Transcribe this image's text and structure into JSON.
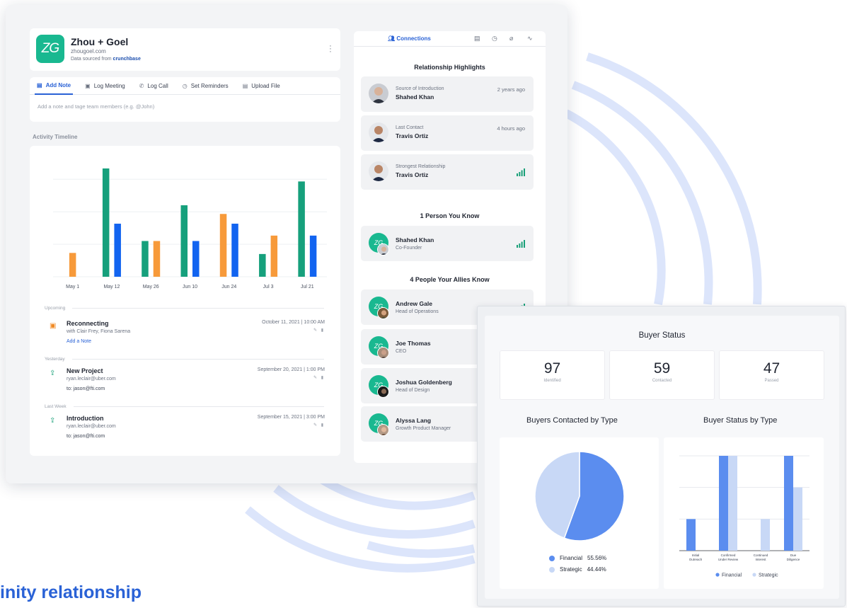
{
  "colors": {
    "accent": "#2a62d6",
    "brand_green": "#19b890",
    "teal_bar": "#16a07c",
    "orange_bar": "#f79a3a",
    "blue_bar": "#1264f0",
    "financial": "#5b8def",
    "strategic": "#c8d8f6"
  },
  "company": {
    "logo_text": "ZG",
    "name": "Zhou + Goel",
    "domain": "zhougoel.com",
    "source_prefix": "Data sourced from",
    "source_name": "crunchbase"
  },
  "note_tabs": [
    {
      "label": "Add Note",
      "icon": "note-icon"
    },
    {
      "label": "Log Meeting",
      "icon": "calendar-icon"
    },
    {
      "label": "Log Call",
      "icon": "phone-icon"
    },
    {
      "label": "Set Reminders",
      "icon": "alarm-icon"
    },
    {
      "label": "Upload File",
      "icon": "file-icon"
    }
  ],
  "note_placeholder": "Add a note and tage team members (e.g. @John)",
  "timeline_label": "Activity Timeline",
  "chart_data": {
    "type": "bar",
    "categories": [
      "May 1",
      "May 12",
      "May 26",
      "Jun 10",
      "Jun 24",
      "Jul 3",
      "Jul 21"
    ],
    "series": [
      {
        "values": [
          0,
          10,
          3.3,
          6.6,
          0,
          2.1,
          8.8
        ],
        "color": "#16a07c"
      },
      {
        "values": [
          2.2,
          0,
          3.3,
          0,
          5.8,
          3.8,
          0
        ],
        "color": "#f79a3a"
      },
      {
        "values": [
          0,
          4.9,
          0,
          3.3,
          4.9,
          0,
          3.8
        ],
        "color": "#1264f0"
      }
    ],
    "ylim": [
      0,
      10
    ],
    "grid": true
  },
  "timeline": {
    "sections": [
      {
        "label": "Upcoming",
        "event": {
          "icon": "calendar-icon",
          "title": "Reconnecting",
          "sub": "with Clair Frey, Fiona Sarena",
          "sub2": "Add a Note",
          "date": "October 11, 2021 | 10:00 AM"
        }
      },
      {
        "label": "Yesterday",
        "event": {
          "icon": "send-icon",
          "title": "New Project",
          "sub": "ryan.leclair@uber.com",
          "sub2": "to: jason@fti.com",
          "date": "September 20, 2021 | 1:00 PM"
        }
      },
      {
        "label": "Last Week",
        "event": {
          "icon": "send-icon",
          "title": "Introduction",
          "sub": "ryan.leclair@uber.com",
          "sub2": "to: jason@fti.com",
          "date": "September 15, 2021 | 3:00 PM"
        }
      }
    ]
  },
  "right_panel": {
    "tab_label": "Connections",
    "highlights_title": "Relationship Highlights",
    "highlights": [
      {
        "label": "Source of Introduction",
        "name": "Shahed Khan",
        "right": "2 years ago"
      },
      {
        "label": "Last Contact",
        "name": "Travis Ortiz",
        "right": "4 hours ago"
      },
      {
        "label": "Strongest Relationship",
        "name": "Travis Ortiz",
        "right": ""
      }
    ],
    "know_title": "1 Person You Know",
    "know": [
      {
        "name": "Shahed Khan",
        "role": "Co-Founder"
      }
    ],
    "allies_title": "4 People Your Allies Know",
    "allies": [
      {
        "name": "Andrew Gale",
        "role": "Head of Operations"
      },
      {
        "name": "Joe Thomas",
        "role": "CEO"
      },
      {
        "name": "Joshua Goldenberg",
        "role": "Head of Design"
      },
      {
        "name": "Alyssa Lang",
        "role": "Growth Product Manager"
      }
    ]
  },
  "buyer": {
    "title": "Buyer Status",
    "stats": [
      {
        "value": "97",
        "label": "Identified"
      },
      {
        "value": "59",
        "label": "Contacted"
      },
      {
        "value": "47",
        "label": "Passed"
      }
    ],
    "pie_title": "Buyers Contacted by Type",
    "bar_title": "Buyer Status by Type",
    "pie_legend": [
      {
        "label": "Financial",
        "value": "55.56%"
      },
      {
        "label": "Strategic",
        "value": "44.44%"
      }
    ],
    "bar_legend": [
      "Financial",
      "Strategic"
    ],
    "bar_categories": [
      [
        "Initial",
        "Outreach"
      ],
      [
        "Confirmed",
        "Under Review"
      ],
      [
        "Continued",
        "Interest"
      ],
      [
        "Due",
        "Diligence"
      ]
    ]
  },
  "buyer_pie_data": {
    "type": "pie",
    "slices": [
      {
        "name": "Financial",
        "value": 55.56
      },
      {
        "name": "Strategic",
        "value": 44.44
      }
    ]
  },
  "buyer_bar_data": {
    "type": "bar",
    "categories": [
      "Initial Outreach",
      "Confirmed Under Review",
      "Continued Interest",
      "Due Diligence"
    ],
    "series": [
      {
        "name": "Financial",
        "values": [
          1,
          3,
          0,
          3
        ]
      },
      {
        "name": "Strategic",
        "values": [
          0,
          3,
          1,
          2
        ]
      }
    ],
    "ylim": [
      0,
      3
    ]
  },
  "tagline": "inity relationship"
}
